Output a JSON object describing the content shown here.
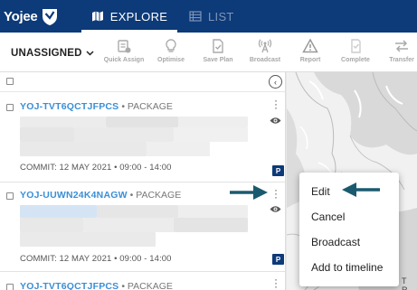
{
  "app": {
    "logo_text": "Yojee"
  },
  "nav": {
    "tabs": [
      {
        "label": "EXPLORE",
        "active": true
      },
      {
        "label": "LIST",
        "active": false
      }
    ]
  },
  "toolbar": {
    "filter_label": "UNASSIGNED",
    "tools": [
      {
        "label": "Quick Assign",
        "icon": "quick-assign-icon"
      },
      {
        "label": "Optimise",
        "icon": "lightbulb-icon"
      },
      {
        "label": "Save Plan",
        "icon": "save-plan-icon"
      },
      {
        "label": "Broadcast",
        "icon": "broadcast-tower-icon"
      },
      {
        "label": "Report",
        "icon": "warning-triangle-icon"
      },
      {
        "label": "Complete",
        "icon": "complete-icon"
      },
      {
        "label": "Transfer",
        "icon": "transfer-arrows-icon"
      }
    ]
  },
  "tasks": [
    {
      "id": "YOJ-TVT6QCTJFPCS",
      "type": "• PACKAGE",
      "commit": "COMMIT: 12 MAY 2021 • 09:00 - 14:00",
      "badge": "P"
    },
    {
      "id": "YOJ-UUWN24K4NAGW",
      "type": "• PACKAGE",
      "commit": "COMMIT: 12 MAY 2021 • 09:00 - 14:00",
      "badge": "P"
    },
    {
      "id": "YOJ-TVT6QCTJFPCS",
      "type": "• PACKAGE",
      "commit": "",
      "badge": ""
    }
  ],
  "context_menu": {
    "items": [
      "Edit",
      "Cancel",
      "Broadcast",
      "Add to timeline"
    ]
  },
  "map": {
    "label": "T R"
  },
  "colors": {
    "nav_bg": "#0d3a78",
    "task_id": "#3a8fd6",
    "annotation_arrow": "#1a5a6e"
  }
}
